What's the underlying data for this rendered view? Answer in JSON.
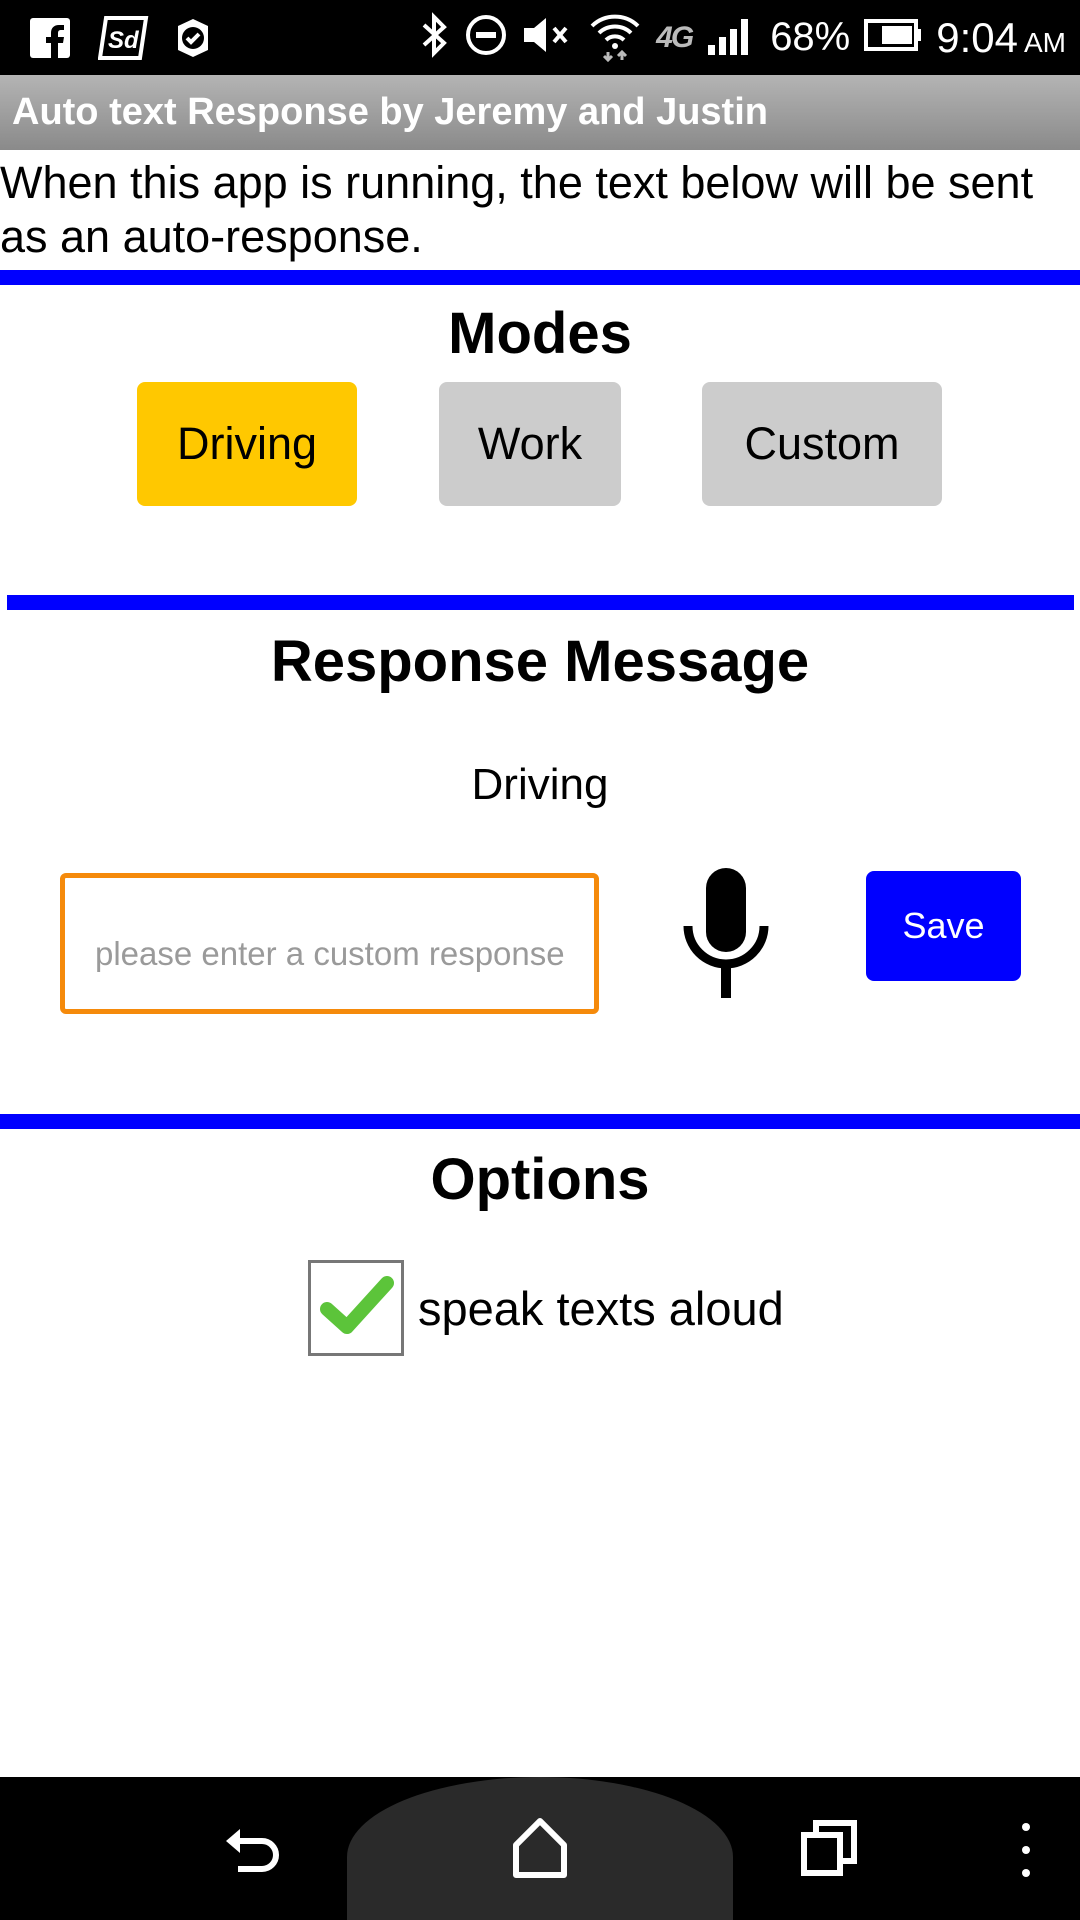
{
  "status_bar": {
    "battery": "68%",
    "time": "9:04",
    "ampm": "AM",
    "network": "4G",
    "icons": [
      "facebook-icon",
      "sd-icon",
      "shield-check-icon",
      "bluetooth-icon",
      "do-not-disturb-icon",
      "mute-icon",
      "wifi-icon",
      "lte-icon",
      "signal-icon",
      "battery-icon"
    ]
  },
  "app": {
    "title": "Auto text Response by Jeremy and Justin",
    "intro": "When this app is running, the text below will be sent as an auto-response."
  },
  "modes": {
    "heading": "Modes",
    "buttons": [
      "Driving",
      "Work",
      "Custom"
    ],
    "selected": "Driving",
    "selected_color": "#ffc800",
    "unselected_color": "#cccccc"
  },
  "response": {
    "heading": "Response Message",
    "current_mode": "Driving",
    "input_value": "",
    "input_placeholder": "please enter a custom response",
    "input_border_color": "#f58a0b",
    "mic_icon": "microphone-icon",
    "save_label": "Save",
    "save_color": "#0000ff"
  },
  "options": {
    "heading": "Options",
    "speak_label": "speak texts aloud",
    "speak_checked": true
  },
  "colors": {
    "divider": "#0000ff"
  },
  "nav_bar": {
    "buttons": [
      "back-icon",
      "home-icon",
      "recents-icon",
      "menu-icon"
    ]
  }
}
